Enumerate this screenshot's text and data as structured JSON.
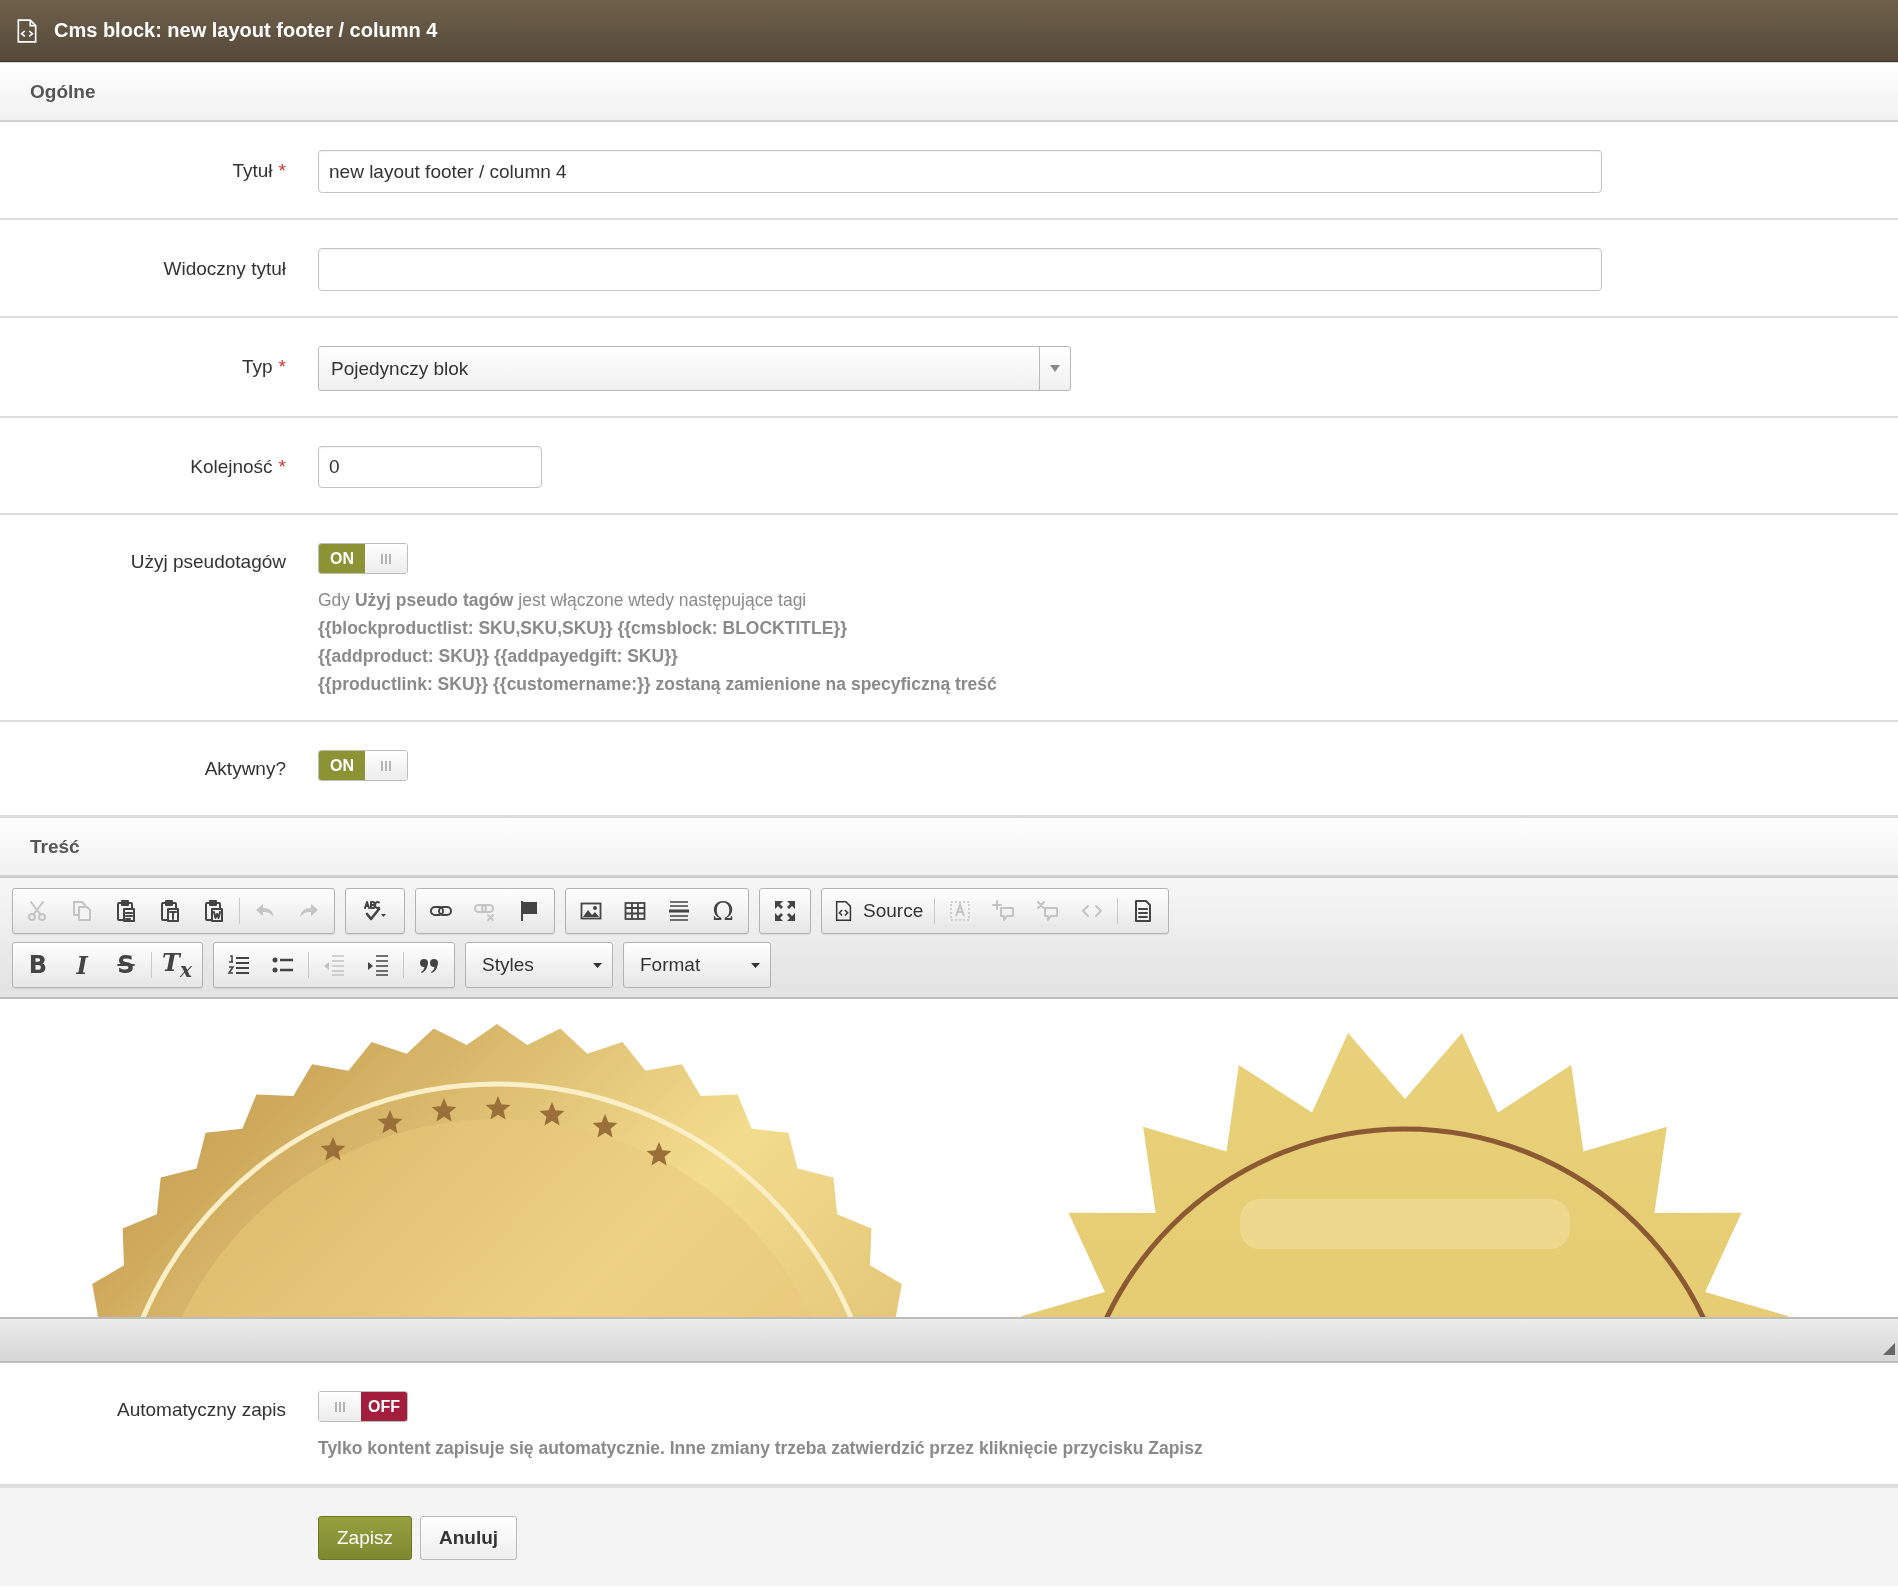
{
  "header": {
    "title": "Cms block: new layout footer / column 4"
  },
  "general": {
    "title": "Ogólne",
    "fields": [
      {
        "kind": "text",
        "label": "Tytuł",
        "required_mark": "*",
        "value": "new layout footer / column 4"
      },
      {
        "kind": "text",
        "label": "Widoczny tytuł"
      },
      {
        "kind": "select",
        "label": "Typ",
        "required_mark": "*",
        "value": "Pojedynczy blok"
      },
      {
        "kind": "number",
        "label": "Kolejność",
        "required_mark": "*",
        "value": "0"
      },
      {
        "kind": "toggle",
        "label": "Użyj pseudotagów",
        "on": true,
        "state_label": "ON",
        "help": [
          {
            "text": "Gdy **Użyj pseudo tagów** jest włączone wtedy następujące tagi",
            "bold": false
          },
          {
            "text": "{{blockproductlist: SKU,SKU,SKU}} {{cmsblock: BLOCKTITLE}}",
            "bold": true
          },
          {
            "text": "{{addproduct: SKU}} {{addpayedgift: SKU}}",
            "bold": true
          },
          {
            "text": "{{productlink: SKU}} {{customername:}} zostaną zamienione na specyficzną treść",
            "bold": true
          }
        ]
      },
      {
        "kind": "toggle",
        "label": "Aktywny?",
        "on": true,
        "state_label": "ON"
      }
    ]
  },
  "content": {
    "title": "Treść",
    "toolbar": [
      [
        {
          "kind": "group",
          "items": [
            {
              "kind": "icon",
              "disabled": true
            },
            {
              "kind": "icon",
              "disabled": true
            },
            {
              "kind": "icon",
              "disabled": false
            },
            {
              "kind": "icon",
              "disabled": false
            },
            {
              "kind": "icon",
              "disabled": false
            },
            {
              "kind": "separator"
            },
            {
              "kind": "icon",
              "disabled": true
            },
            {
              "kind": "icon",
              "disabled": true
            }
          ]
        },
        {
          "kind": "group",
          "items": [
            {
              "kind": "icon",
              "disabled": false
            }
          ]
        },
        {
          "kind": "group",
          "items": [
            {
              "kind": "icon",
              "disabled": false
            },
            {
              "kind": "icon",
              "disabled": true
            },
            {
              "kind": "icon",
              "disabled": false
            }
          ]
        },
        {
          "kind": "group",
          "items": [
            {
              "kind": "icon",
              "disabled": false
            },
            {
              "kind": "icon",
              "disabled": false
            },
            {
              "kind": "icon",
              "disabled": false
            },
            {
              "kind": "glyph",
              "label": "Ω",
              "disabled": false
            }
          ]
        },
        {
          "kind": "group",
          "items": [
            {
              "kind": "icon",
              "disabled": false
            }
          ]
        },
        {
          "kind": "group",
          "items": [
            {
              "kind": "text",
              "label": "Source",
              "disabled": false
            },
            {
              "kind": "separator"
            },
            {
              "kind": "icon",
              "disabled": true
            },
            {
              "kind": "icon",
              "disabled": true
            },
            {
              "kind": "icon",
              "disabled": true
            },
            {
              "kind": "icon",
              "disabled": true
            },
            {
              "kind": "separator"
            },
            {
              "kind": "icon",
              "disabled": false
            }
          ]
        }
      ],
      [
        {
          "kind": "group",
          "items": [
            {
              "kind": "glyph",
              "label": "B",
              "disabled": false
            },
            {
              "kind": "glyph",
              "label": "I",
              "disabled": false
            },
            {
              "kind": "glyph",
              "label": "S",
              "disabled": false
            },
            {
              "kind": "separator"
            },
            {
              "kind": "glyph",
              "label": "T$_{x}$",
              "disabled": false
            }
          ]
        },
        {
          "kind": "group",
          "items": [
            {
              "kind": "icon",
              "disabled": false
            },
            {
              "kind": "icon",
              "disabled": false
            },
            {
              "kind": "separator"
            },
            {
              "kind": "icon",
              "disabled": true
            },
            {
              "kind": "icon",
              "disabled": false
            },
            {
              "kind": "separator"
            },
            {
              "kind": "icon",
              "disabled": false
            }
          ]
        },
        {
          "kind": "combo",
          "label": "Styles"
        },
        {
          "kind": "combo",
          "label": "Format"
        }
      ]
    ],
    "body": {
      "kind": "picture"
    }
  },
  "autosave": {
    "label": "Automatyczny zapis",
    "on": false,
    "state_label": "OFF",
    "help": [
      {
        "text": "Tylko kontent zapisuje się automatycznie. Inne zmiany trzeba zatwierdzić przez kliknięcie przycisku Zapisz",
        "bold": true
      }
    ]
  },
  "actions": [
    {
      "kind": "primary",
      "label": "Zapisz"
    },
    {
      "kind": "secondary",
      "label": "Anuluj"
    }
  ]
}
